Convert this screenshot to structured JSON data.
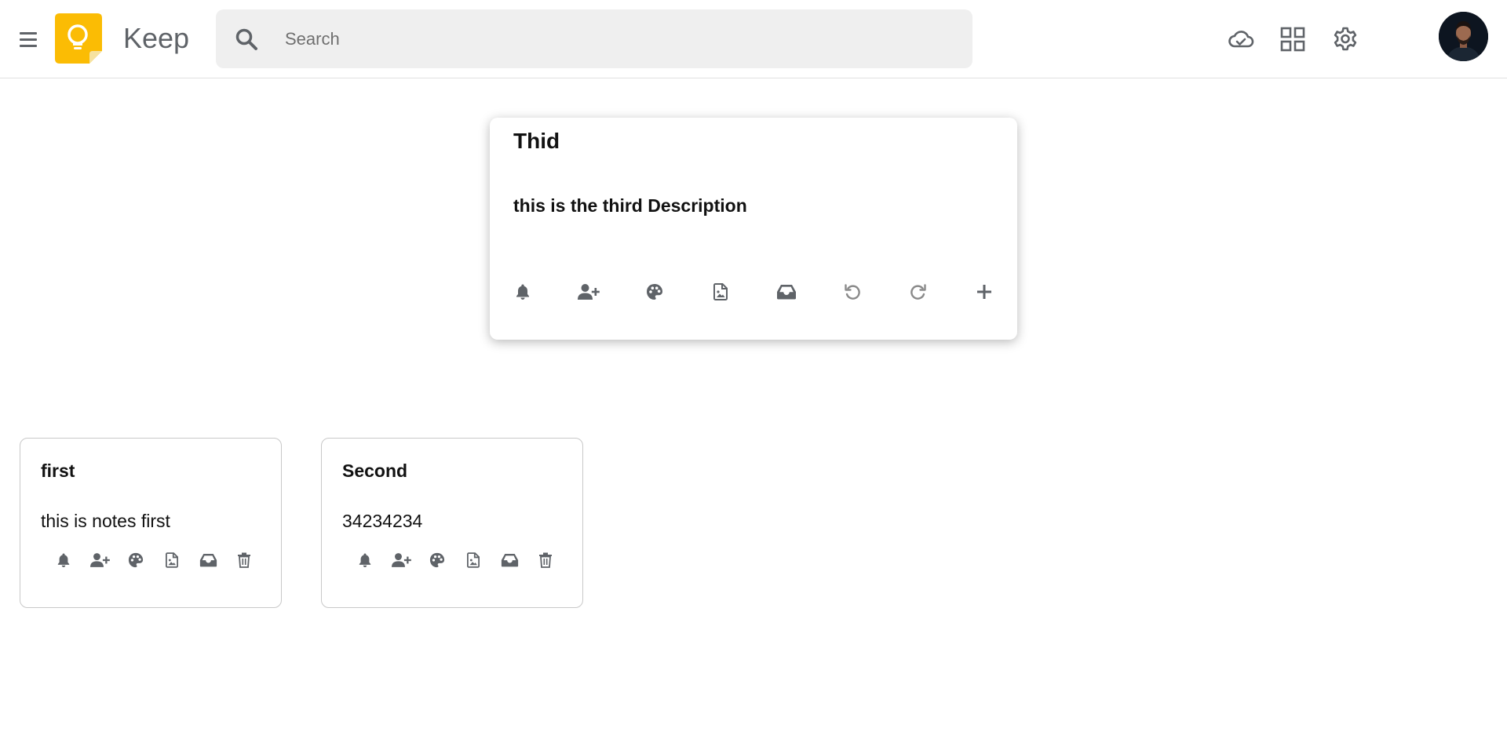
{
  "header": {
    "app_name": "Keep",
    "search_placeholder": "Search",
    "icons": [
      "menu-icon",
      "keep-logo",
      "search-icon",
      "cloud-sync-icon",
      "grid-view-icon",
      "gear-icon",
      "avatar"
    ]
  },
  "editor": {
    "title": "Thid",
    "description": "this is the third Description",
    "toolbar": [
      "bell-icon",
      "add-collaborator-icon",
      "palette-icon",
      "image-icon",
      "archive-icon",
      "undo-icon",
      "redo-icon",
      "plus-icon"
    ]
  },
  "notes": [
    {
      "title": "first",
      "body": "this is notes first"
    },
    {
      "title": "Second",
      "body": "34234234"
    }
  ],
  "note_actions": [
    "bell-icon",
    "add-collaborator-icon",
    "palette-icon",
    "image-icon",
    "archive-icon",
    "trash-icon"
  ],
  "colors": {
    "icon_gray": "#5f6368",
    "search_bg": "#efefef",
    "logo_yellow": "#fbbc04"
  }
}
